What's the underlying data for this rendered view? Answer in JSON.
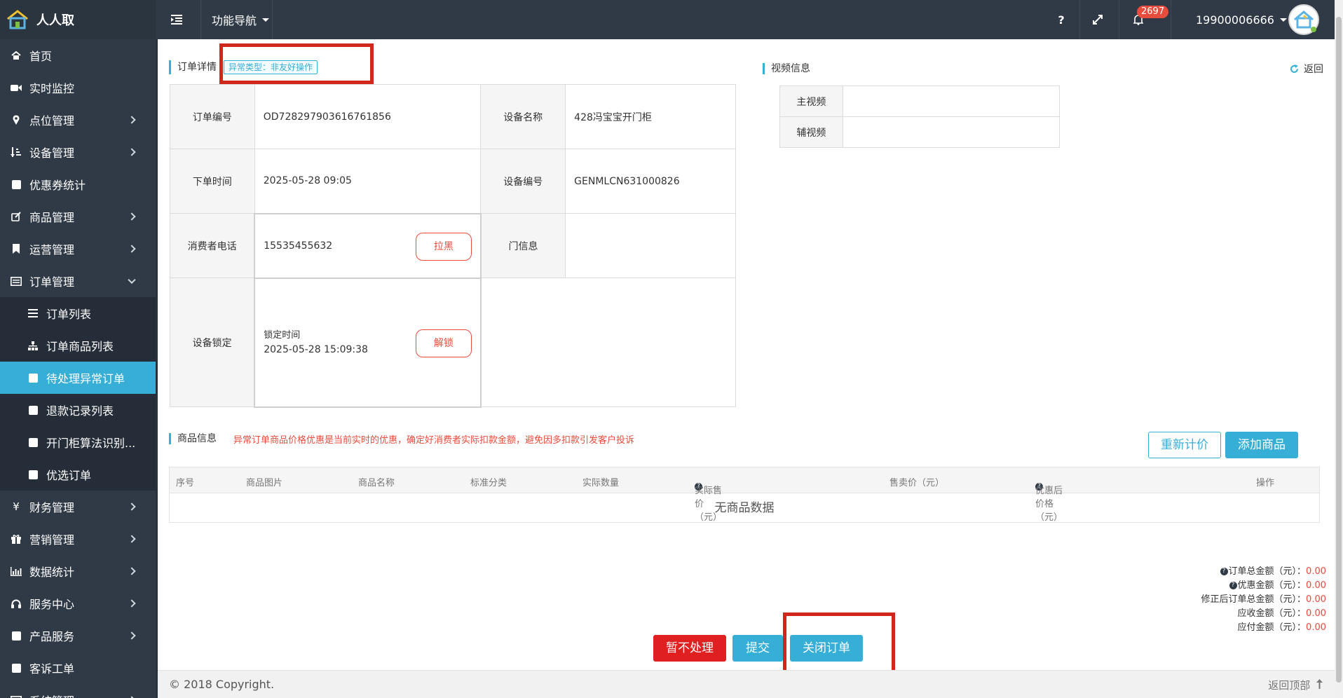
{
  "app": {
    "name": "人人取"
  },
  "topbar": {
    "nav_label": "功能导航",
    "help_label": "?",
    "notification_count": "2697",
    "user_phone": "19900006666"
  },
  "sidebar": {
    "items": [
      {
        "label": "首页",
        "icon": "home-icon"
      },
      {
        "label": "实时监控",
        "icon": "video-camera-icon"
      },
      {
        "label": "点位管理",
        "icon": "map-marker-icon"
      },
      {
        "label": "设备管理",
        "icon": "sort-icon"
      },
      {
        "label": "优惠券统计",
        "icon": "square-icon"
      },
      {
        "label": "商品管理",
        "icon": "edit-icon"
      },
      {
        "label": "运营管理",
        "icon": "bookmark-icon"
      },
      {
        "label": "订单管理",
        "icon": "list-alt-icon"
      },
      {
        "label": "订单列表",
        "icon": "bars-icon"
      },
      {
        "label": "订单商品列表",
        "icon": "sitemap-icon"
      },
      {
        "label": "待处理异常订单",
        "icon": "square-icon"
      },
      {
        "label": "退款记录列表",
        "icon": "square-icon"
      },
      {
        "label": "开门柜算法识别...",
        "icon": "square-icon"
      },
      {
        "label": "优选订单",
        "icon": "square-icon"
      },
      {
        "label": "财务管理",
        "icon": "yen-icon"
      },
      {
        "label": "营销管理",
        "icon": "gift-icon"
      },
      {
        "label": "数据统计",
        "icon": "bar-chart-icon"
      },
      {
        "label": "服务中心",
        "icon": "headphones-icon"
      },
      {
        "label": "产品服务",
        "icon": "square-icon"
      },
      {
        "label": "客诉工单",
        "icon": "square-icon"
      },
      {
        "label": "系统管理",
        "icon": "list-alt-icon"
      }
    ]
  },
  "order": {
    "section_title": "订单详情",
    "exception_tag": "异常类型：非友好操作",
    "order_no_label": "订单编号",
    "order_no": "OD728297903616761856",
    "device_name_label": "设备名称",
    "device_name": "428冯宝宝开门柜",
    "order_time_label": "下单时间",
    "order_time": "2025-05-28 09:05",
    "device_no_label": "设备编号",
    "device_no": "GENMLCN631000826",
    "phone_label": "消费者电话",
    "phone": "15535455632",
    "blacklist_label": "拉黑",
    "door_info_label": "门信息",
    "door_info": "",
    "lock_label": "设备锁定",
    "lock_time_label": "锁定时间",
    "lock_time": "2025-05-28 15:09:38",
    "unlock_label": "解锁"
  },
  "video": {
    "section_title": "视频信息",
    "back_label": "返回",
    "main_label": "主视频",
    "main_value": "",
    "aux_label": "辅视频",
    "aux_value": ""
  },
  "goods": {
    "section_title": "商品信息",
    "warning": "异常订单商品价格优惠是当前实时的优惠，确定好消费者实际扣款金额，避免因多扣款引发客户投诉",
    "reprice_label": "重新计价",
    "add_label": "添加商品",
    "columns": [
      "序号",
      "商品图片",
      "商品名称",
      "标准分类",
      "实际数量",
      "实际售价（元）",
      "售卖价（元）",
      "优惠后价格（元）",
      "操作"
    ],
    "empty_text": "无商品数据"
  },
  "summary": {
    "total_label": "订单总金额（元）：",
    "total": "0.00",
    "discount_label": "优惠金额（元）：",
    "discount": "0.00",
    "revised_label": "修正后订单总金额（元）：",
    "revised": "0.00",
    "receivable_label": "应收金额（元）：",
    "receivable": "0.00",
    "payable_label": "应付金额（元）：",
    "payable": "0.00"
  },
  "actions": {
    "ignore_label": "暂不处理",
    "submit_label": "提交",
    "close_label": "关闭订单"
  },
  "footer": {
    "copyright": "© 2018 Copyright.",
    "back_to_top": "返回顶部"
  },
  "colors": {
    "sidebar_bg": "#2f3a46",
    "accent": "#36aed6",
    "danger": "#e84c3d",
    "annotation": "#d0261b"
  }
}
